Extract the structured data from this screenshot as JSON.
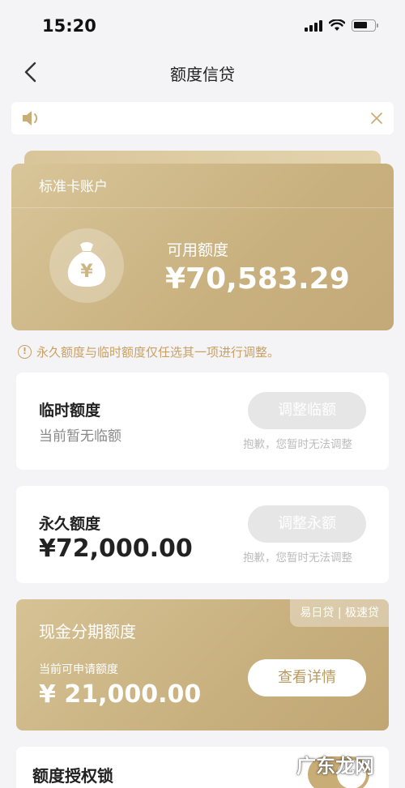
{
  "status": {
    "time": "15:20"
  },
  "nav": {
    "title": "额度信贷"
  },
  "account": {
    "title": "标准卡账户",
    "avail_label": "可用额度",
    "avail_value": "¥70,583.29"
  },
  "warning": "永久额度与临时额度仅任选其一项进行调整。",
  "temp_limit": {
    "title": "临时额度",
    "sub": "当前暂无临额",
    "button": "调整临额",
    "hint": "抱歉，您暂时无法调整"
  },
  "perm_limit": {
    "title": "永久额度",
    "amount": "¥72,000.00",
    "button": "调整永额",
    "hint": "抱歉，您暂时无法调整"
  },
  "cash": {
    "tag": "易日贷 | 极速贷",
    "title": "现金分期额度",
    "sub": "当前可申请额度",
    "value": "¥ 21,000.00",
    "button": "查看详情"
  },
  "lock": {
    "title": "额度授权锁"
  },
  "watermark": "广东龙网",
  "colors": {
    "gold": "#c9ad76",
    "warning": "#c9a063"
  }
}
